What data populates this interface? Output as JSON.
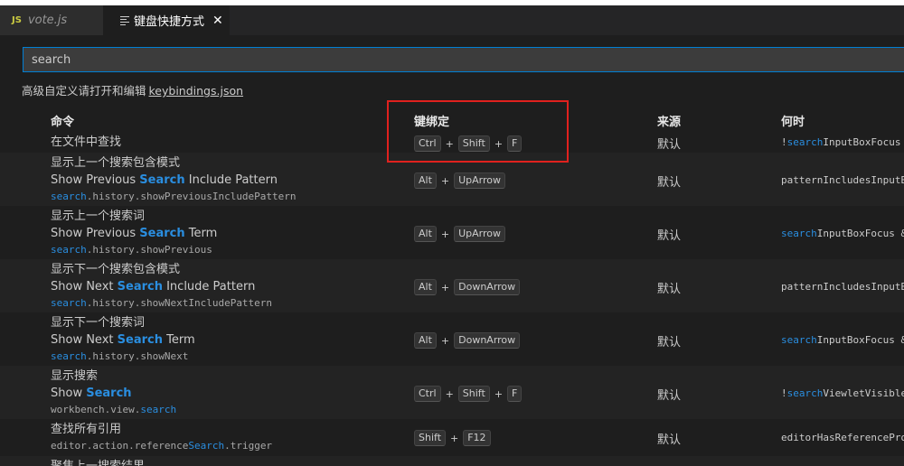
{
  "tabs": [
    {
      "icon": "JS",
      "label": "vote.js"
    },
    {
      "label": "键盘快捷方式",
      "close": "✕"
    }
  ],
  "search": {
    "value": "search"
  },
  "advanced": {
    "text": "高级自定义请打开和编辑",
    "link": "keybindings.json"
  },
  "columns": {
    "command": "命令",
    "keybinding": "键绑定",
    "source": "来源",
    "when": "何时"
  },
  "rows": [
    {
      "cn": "在文件中查找",
      "keys": [
        "Ctrl",
        "Shift",
        "F"
      ],
      "source": "默认",
      "when": [
        [
          "!",
          false
        ],
        [
          "search",
          true
        ],
        [
          "InputBoxFocus",
          false
        ]
      ]
    },
    {
      "cn": "显示上一个搜索包含模式",
      "en": [
        [
          "Show Previous ",
          false
        ],
        [
          "Search",
          true
        ],
        [
          " Include Pattern",
          false
        ]
      ],
      "id": [
        [
          "search",
          true
        ],
        [
          ".history.showPreviousIncludePattern",
          false
        ]
      ],
      "keys": [
        "Alt",
        "UpArrow"
      ],
      "source": "默认",
      "when": [
        [
          "patternIncludesInputBo",
          false
        ]
      ]
    },
    {
      "cn": "显示上一个搜索词",
      "en": [
        [
          "Show Previous ",
          false
        ],
        [
          "Search",
          true
        ],
        [
          " Term",
          false
        ]
      ],
      "id": [
        [
          "search",
          true
        ],
        [
          ".history.showPrevious",
          false
        ]
      ],
      "keys": [
        "Alt",
        "UpArrow"
      ],
      "source": "默认",
      "when": [
        [
          "search",
          true
        ],
        [
          "InputBoxFocus &&",
          false
        ]
      ]
    },
    {
      "cn": "显示下一个搜索包含模式",
      "en": [
        [
          "Show Next ",
          false
        ],
        [
          "Search",
          true
        ],
        [
          " Include Pattern",
          false
        ]
      ],
      "id": [
        [
          "search",
          true
        ],
        [
          ".history.showNextIncludePattern",
          false
        ]
      ],
      "keys": [
        "Alt",
        "DownArrow"
      ],
      "source": "默认",
      "when": [
        [
          "patternIncludesInputBo",
          false
        ]
      ]
    },
    {
      "cn": "显示下一个搜索词",
      "en": [
        [
          "Show Next ",
          false
        ],
        [
          "Search",
          true
        ],
        [
          " Term",
          false
        ]
      ],
      "id": [
        [
          "search",
          true
        ],
        [
          ".history.showNext",
          false
        ]
      ],
      "keys": [
        "Alt",
        "DownArrow"
      ],
      "source": "默认",
      "when": [
        [
          "search",
          true
        ],
        [
          "InputBoxFocus &&",
          false
        ]
      ]
    },
    {
      "cn": "显示搜索",
      "en": [
        [
          "Show ",
          false
        ],
        [
          "Search",
          true
        ]
      ],
      "id": [
        [
          "workbench.view.",
          false
        ],
        [
          "search",
          true
        ]
      ],
      "keys": [
        "Ctrl",
        "Shift",
        "F"
      ],
      "source": "默认",
      "when": [
        [
          "!",
          false
        ],
        [
          "search",
          true
        ],
        [
          "ViewletVisible",
          false
        ]
      ]
    },
    {
      "cn": "查找所有引用",
      "id": [
        [
          "editor.action.reference",
          false
        ],
        [
          "Search",
          true
        ],
        [
          ".trigger",
          false
        ]
      ],
      "keys": [
        "Shift",
        "F12"
      ],
      "source": "默认",
      "when": [
        [
          "editorHasReferenceProv",
          false
        ]
      ]
    },
    {
      "cn": "聚焦上一搜索结果",
      "keys": [],
      "source": "",
      "when": []
    }
  ]
}
